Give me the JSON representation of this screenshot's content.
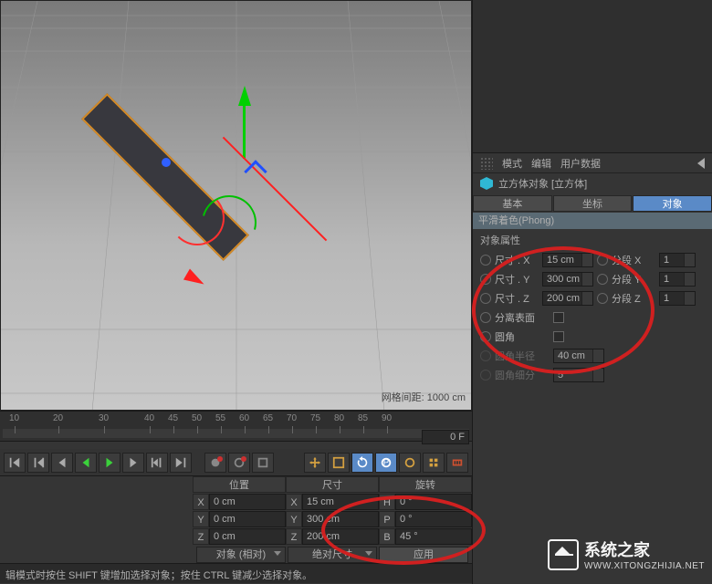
{
  "viewport": {
    "grid_spacing": "网格间距: 1000 cm"
  },
  "timeline": {
    "ticks": [
      "10",
      "20",
      "30",
      "40",
      "45",
      "50",
      "55",
      "60",
      "65",
      "70",
      "75",
      "80",
      "85",
      "90"
    ],
    "frame": "0 F"
  },
  "coords": {
    "headers": {
      "position": "位置",
      "size": "尺寸",
      "rotation": "旋转"
    },
    "labels": {
      "x": "X",
      "y": "Y",
      "z": "Z",
      "x2": "X",
      "y2": "Y",
      "z2": "Z",
      "h": "H",
      "p": "P",
      "b": "B"
    },
    "pos": {
      "x": "0 cm",
      "y": "0 cm",
      "z": "0 cm"
    },
    "size": {
      "x": "15 cm",
      "y": "300 cm",
      "z": "200 cm"
    },
    "rot": {
      "h": "0 °",
      "p": "0 °",
      "b": "45 °"
    },
    "footer": {
      "mode1": "对象 (相对)",
      "mode2": "绝对尺寸",
      "apply": "应用"
    }
  },
  "status": "辑模式时按住 SHIFT 键增加选择对象；按住 CTRL 键减少选择对象。",
  "attr_panel": {
    "menus": {
      "mode": "模式",
      "edit": "编辑",
      "userdata": "用户数据"
    },
    "title": "立方体对象 [立方体]",
    "tabs": {
      "basic": "基本",
      "coord": "坐标",
      "object": "对象"
    },
    "phong": "平滑着色(Phong)",
    "section_title": "对象属性",
    "size_x_label": "尺寸 . X",
    "size_x": "15 cm",
    "size_y_label": "尺寸 . Y",
    "size_y": "300 cm",
    "size_z_label": "尺寸 . Z",
    "size_z": "200 cm",
    "seg_x_label": "分段 X",
    "seg_x": "1",
    "seg_y_label": "分段 Y",
    "seg_y": "1",
    "seg_z_label": "分段 Z",
    "seg_z": "1",
    "separate_label": "分离表面",
    "fillet_label": "圆角",
    "fillet_radius_label": "圆角半径",
    "fillet_radius": "40 cm",
    "fillet_sub_label": "圆角细分",
    "fillet_sub": "5"
  },
  "watermark": {
    "title": "系统之家",
    "url": "WWW.XITONGZHIJIA.NET"
  }
}
